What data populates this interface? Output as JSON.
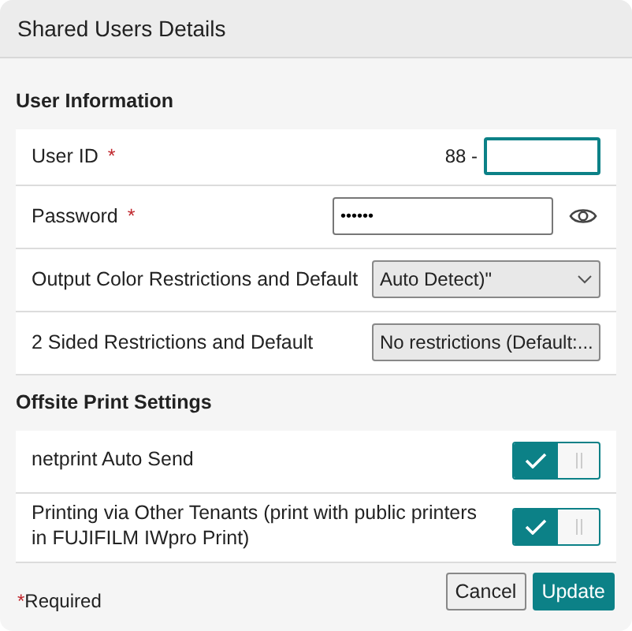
{
  "dialog": {
    "title": "Shared Users Details"
  },
  "sections": [
    {
      "title": "User Information",
      "rows": [
        {
          "kind": "id",
          "label": "User ID",
          "mark": "*",
          "prefix": "88 -"
        },
        {
          "kind": "password",
          "label": "Password",
          "mark": "*",
          "value": "••••••"
        },
        {
          "kind": "select",
          "label": "Output Color Restrictions and Default",
          "value": "Auto Detect)\""
        },
        {
          "kind": "select",
          "label": "2 Sided Restrictions and Default",
          "value": "No restrictions (Default:..."
        }
      ]
    },
    {
      "title": "Offsite Print Settings",
      "rows": [
        {
          "kind": "toggle",
          "label": "netprint Auto Send",
          "on": true
        },
        {
          "kind": "toggle",
          "label": "Printing via Other Tenants (print with public printers in FUJIFILM IWpro Print)",
          "on": true
        }
      ]
    }
  ],
  "footer": {
    "mark": "*",
    "note": "Required",
    "buttons": [
      {
        "label": "Cancel",
        "kind": "secondary"
      },
      {
        "label": "Update",
        "kind": "primary"
      }
    ]
  }
}
